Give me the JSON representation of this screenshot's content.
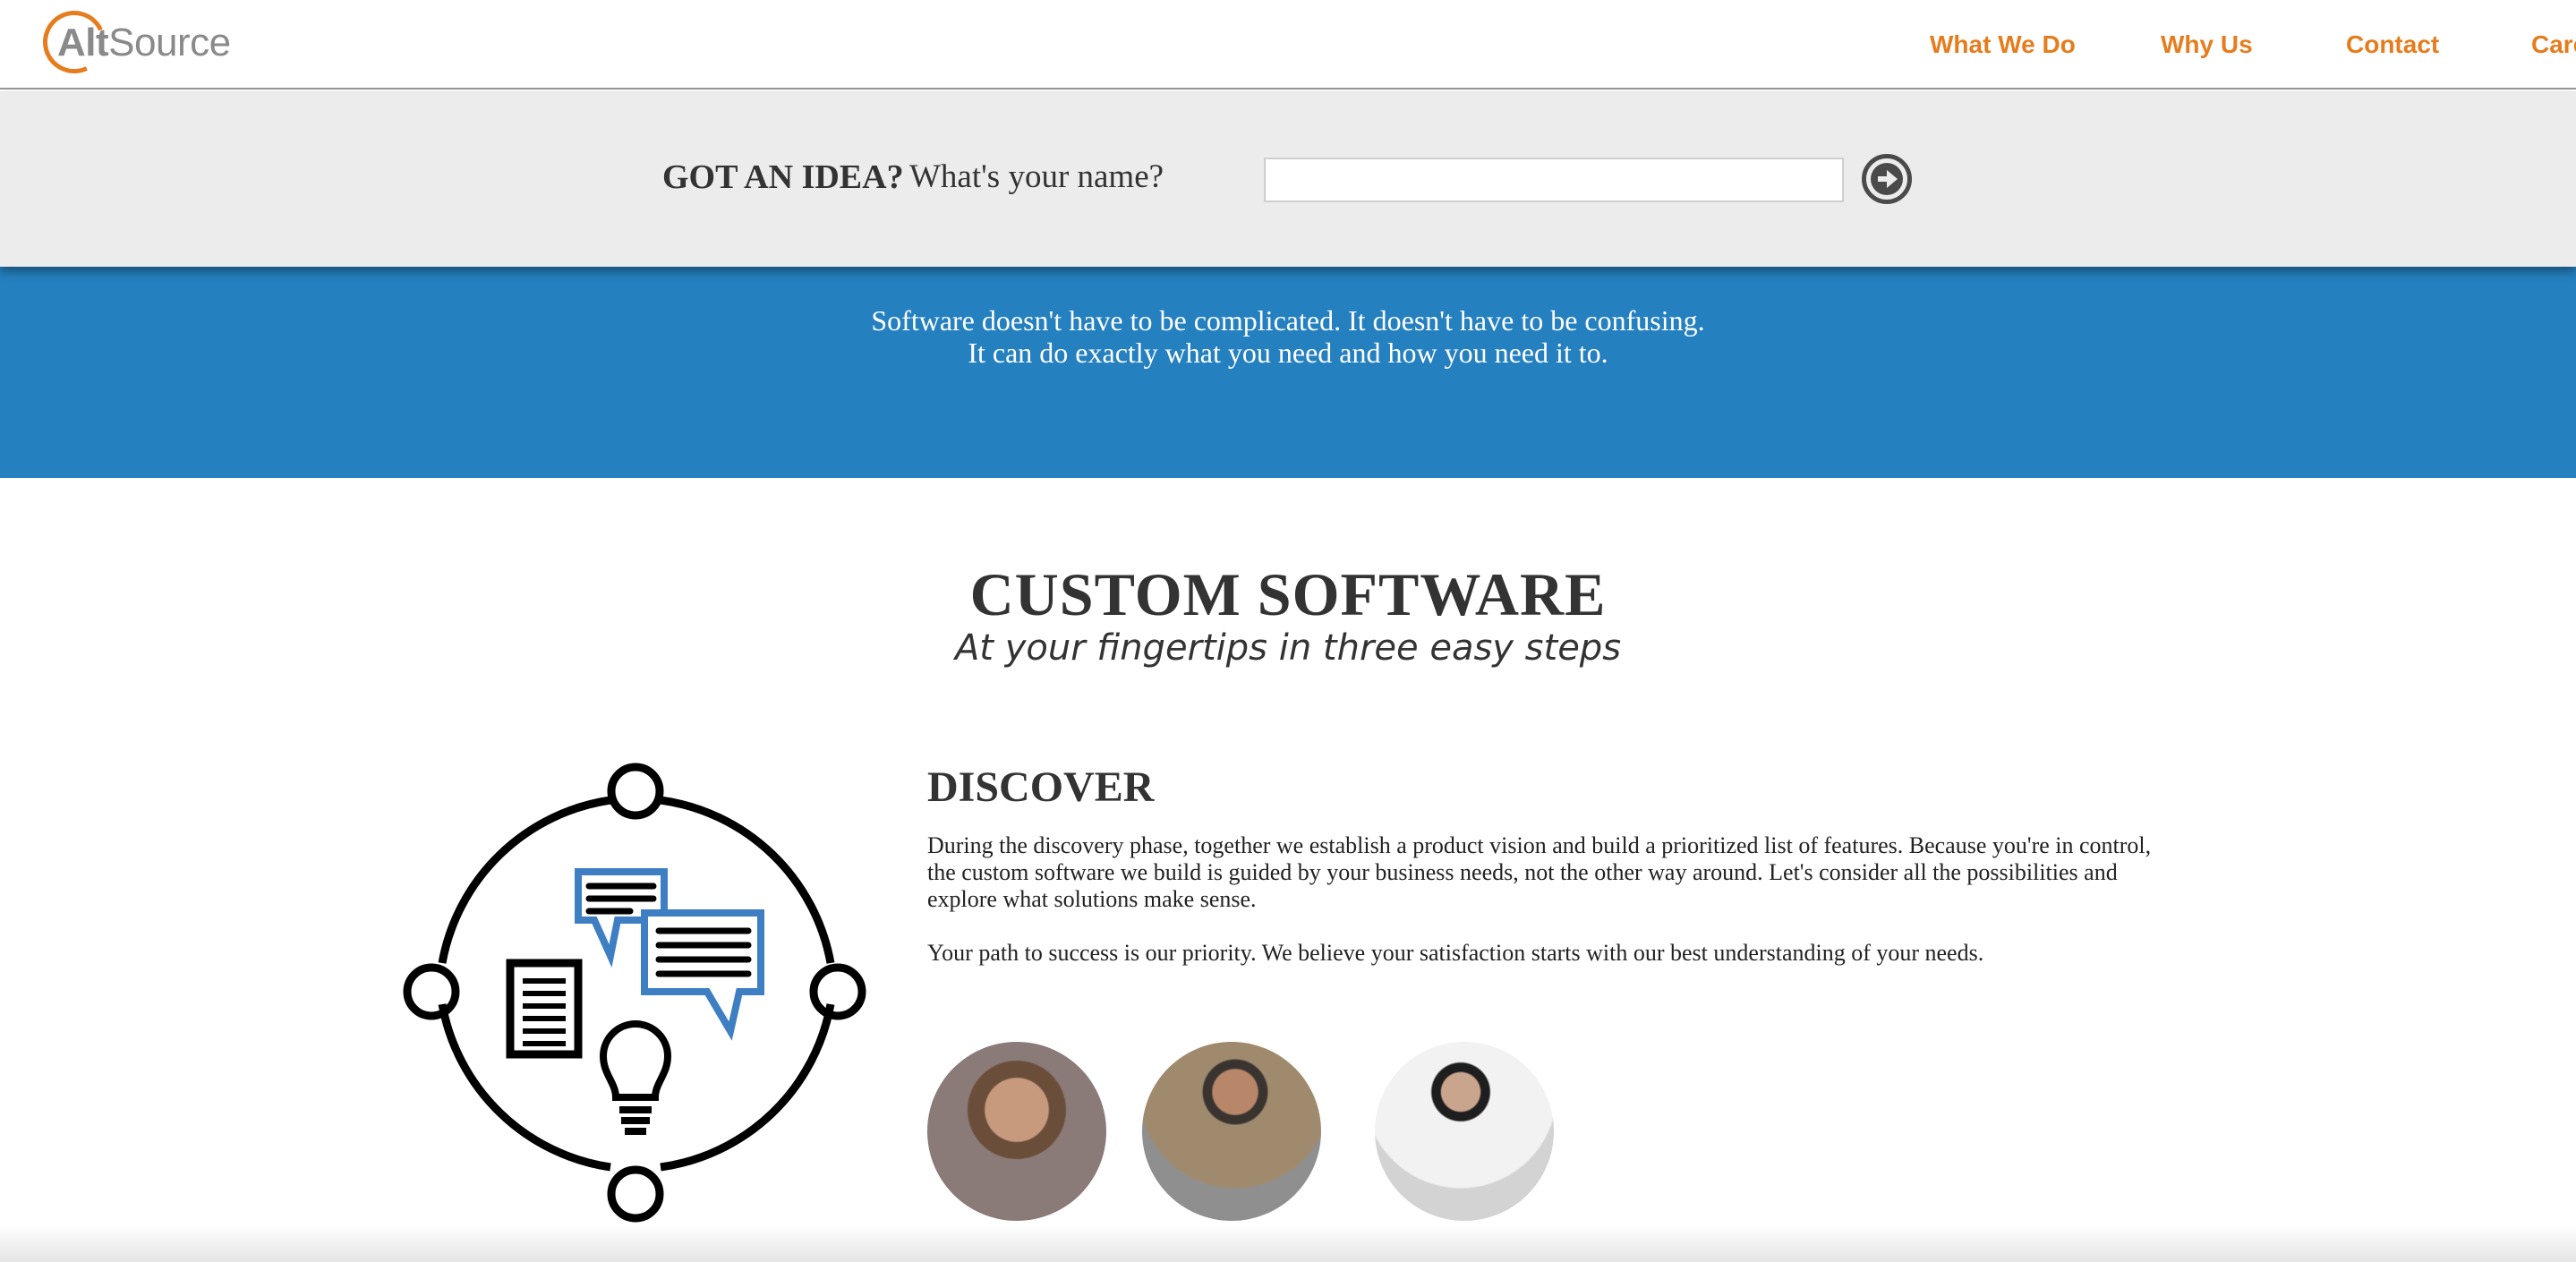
{
  "header": {
    "logo_prefix": "Alt",
    "logo_suffix": "Source",
    "nav": [
      {
        "label": "What We Do"
      },
      {
        "label": "Why Us"
      },
      {
        "label": "Contact"
      },
      {
        "label": "Careers"
      }
    ]
  },
  "idea_bar": {
    "label": "GOT AN IDEA?",
    "question": "What's your name?",
    "name_value": "",
    "submit_icon": "arrow-right-circle-icon"
  },
  "banner": {
    "line1": "Software doesn't have to be complicated. It doesn't have to be confusing.",
    "line2": "It can do exactly what you need and how you need it to."
  },
  "hero": {
    "title": "CUSTOM SOFTWARE",
    "subtitle": "At your fingertips in three easy steps"
  },
  "discover": {
    "title": "DISCOVER",
    "paragraph1": "During the discovery phase, together we establish a product vision and build a prioritized list of features. Because you're in control, the custom software we build is guided by your business needs, not the other way around. Let's consider all the possibilities and explore what solutions make sense.",
    "paragraph2": "Your path to success is our priority. We believe your satisfaction starts with our best understanding of your needs.",
    "illustration_icons": [
      "chat-bubbles-icon",
      "document-icon",
      "lightbulb-icon"
    ]
  },
  "colors": {
    "brand_orange": "#e57d1e",
    "banner_blue": "#2580c0",
    "accent_blue": "#3d7fc2",
    "bar_gray": "#ececec"
  }
}
